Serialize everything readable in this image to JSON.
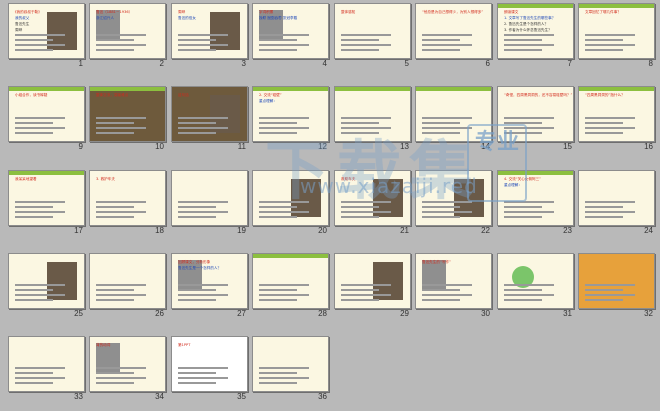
{
  "title": "",
  "slides": [
    {
      "num": "1",
      "lines": [
        "《我的叔叔于勒》",
        "我的叔父",
        "鲁迅先生",
        "周晔"
      ]
    },
    {
      "num": "2",
      "lines": [
        "鲁迅（1881－1936）",
        "浙江绍兴人"
      ]
    },
    {
      "num": "3",
      "lines": [
        "周晔",
        "鲁迅的侄女"
      ]
    },
    {
      "num": "4",
      "lines": [
        "字词积累",
        "挽联 囫囵吞枣 张冠李戴"
      ]
    },
    {
      "num": "5",
      "lines": [
        "整体感知"
      ]
    },
    {
      "num": "6",
      "lines": [
        "“他总是为自己想得少，为别人想得多”"
      ]
    },
    {
      "num": "7",
      "lines": [
        "朗读课文",
        "1. 文章写了鲁迅先生的哪些事？",
        "2. 鲁迅先生是个怎样的人？",
        "3. 作者为什么怀念鲁迅先生？"
      ]
    },
    {
      "num": "8",
      "lines": [
        "文章回忆了哪几件事？"
      ]
    },
    {
      "num": "9",
      "lines": [
        "小组合作，读书释疑"
      ]
    },
    {
      "num": "10",
      "lines": [
        "整体交流，突破难点"
      ]
    },
    {
      "num": "11",
      "lines": [
        "这句话"
      ]
    },
    {
      "num": "12",
      "lines": [
        "2. 交流“碰壁”",
        "重点理解："
      ]
    },
    {
      "num": "13",
      "lines": [
        ""
      ]
    },
    {
      "num": "14",
      "lines": [
        ""
      ]
    },
    {
      "num": "15",
      "lines": [
        "“奇怪，四周黑洞洞的，还不容易碰壁吗？”"
      ]
    },
    {
      "num": "16",
      "lines": [
        "“四周黑洞洞的”指什么？"
      ]
    },
    {
      "num": "17",
      "lines": [
        "我呆呆地望着"
      ]
    },
    {
      "num": "18",
      "lines": [
        "3. 救护车夫"
      ]
    },
    {
      "num": "19",
      "lines": [
        ""
      ]
    },
    {
      "num": "20",
      "lines": [
        ""
      ]
    },
    {
      "num": "21",
      "lines": [
        "救助车夫"
      ]
    },
    {
      "num": "22",
      "lines": [
        ""
      ]
    },
    {
      "num": "23",
      "lines": [
        "4. 交流“关心女佣阿三”",
        "重点理解："
      ]
    },
    {
      "num": "24",
      "lines": [
        ""
      ]
    },
    {
      "num": "25",
      "lines": [
        ""
      ]
    },
    {
      "num": "26",
      "lines": [
        ""
      ]
    },
    {
      "num": "27",
      "lines": [
        "回顾课文，分析形象",
        "鲁迅先生是一个怎样的人？"
      ]
    },
    {
      "num": "28",
      "lines": [
        ""
      ]
    },
    {
      "num": "29",
      "lines": [
        ""
      ]
    },
    {
      "num": "30",
      "lines": [
        "鲁迅先生的“写作”"
      ]
    },
    {
      "num": "31",
      "lines": [
        ""
      ]
    },
    {
      "num": "32",
      "lines": [
        ""
      ]
    },
    {
      "num": "33",
      "lines": [
        ""
      ]
    },
    {
      "num": "34",
      "lines": [
        "背的动词"
      ]
    },
    {
      "num": "35",
      "lines": [
        "第1PPT"
      ]
    },
    {
      "num": "36",
      "lines": [
        ""
      ]
    }
  ],
  "watermark": {
    "main": "下载集",
    "badge": "专业",
    "url": "www.xiazaiji.red"
  }
}
